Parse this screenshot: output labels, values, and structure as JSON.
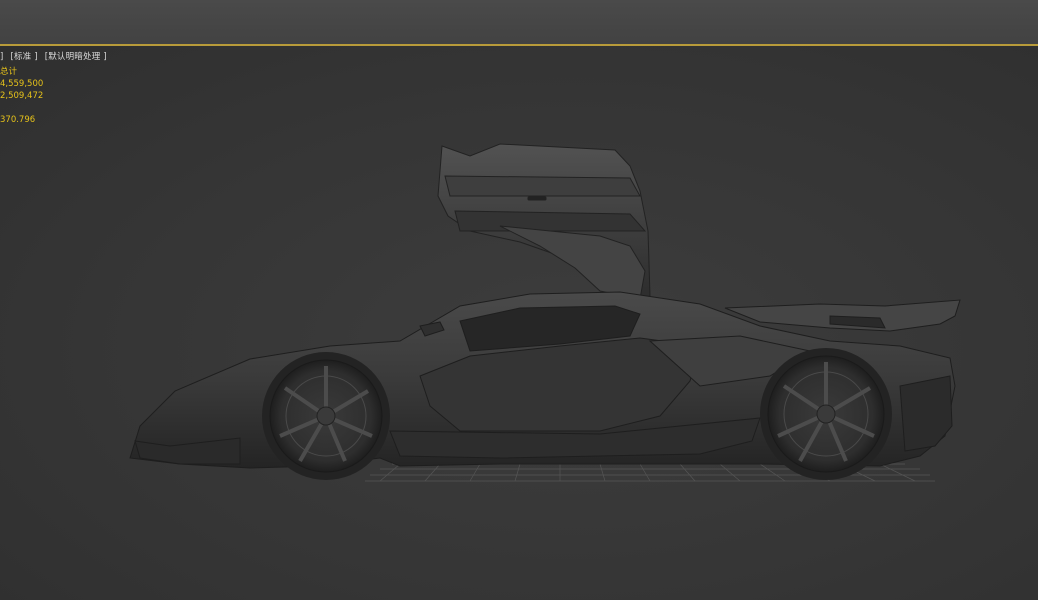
{
  "viewport": {
    "label_parts": [
      "]",
      "[标准 ]",
      "[默认明暗处理 ]"
    ]
  },
  "stats": {
    "title": "总计",
    "polys": "4,559,500",
    "verts": "2,509,472",
    "fps": "370.796"
  },
  "scene": {
    "object": "car-model",
    "grid": "ground-grid"
  }
}
